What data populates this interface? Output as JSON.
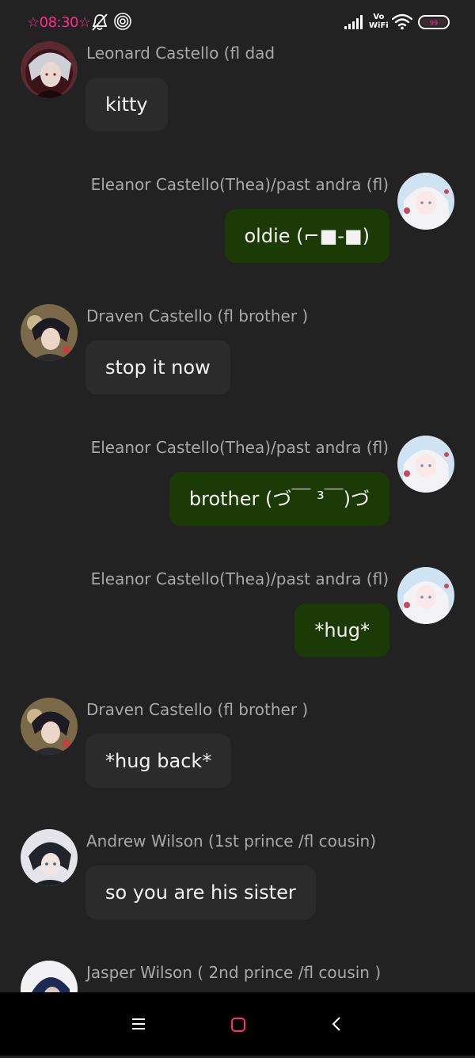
{
  "status_bar": {
    "time": "☆08:30☆",
    "network_badge_top": "Vo",
    "network_badge_bottom": "WiFi",
    "icons": [
      "bell-off-icon",
      "fingerprint-icon",
      "signal-icon",
      "wifi-icon",
      "battery-icon"
    ]
  },
  "messages": [
    {
      "sender": "Leonard Castello (fl dad",
      "text": "kitty",
      "side": "left",
      "avatar": "avatar-leonard"
    },
    {
      "sender": "Eleanor Castello(Thea)/past andra (fl)",
      "text": "oldie (⌐■-■)",
      "side": "right",
      "avatar": "avatar-eleanor"
    },
    {
      "sender": "Draven Castello (fl brother )",
      "text": "stop it now",
      "side": "left",
      "avatar": "avatar-draven"
    },
    {
      "sender": "Eleanor Castello(Thea)/past andra (fl)",
      "text": "brother (づ￣ ³￣)づ",
      "side": "right",
      "avatar": "avatar-eleanor"
    },
    {
      "sender": "Eleanor Castello(Thea)/past andra (fl)",
      "text": "*hug*",
      "side": "right",
      "avatar": "avatar-eleanor"
    },
    {
      "sender": "Draven Castello (fl brother )",
      "text": "*hug back*",
      "side": "left",
      "avatar": "avatar-draven"
    },
    {
      "sender": "Andrew Wilson (1st prince /fl cousin)",
      "text": "so you are his sister",
      "side": "left",
      "avatar": "avatar-andrew"
    },
    {
      "sender": "Jasper Wilson ( 2nd prince /fl cousin )",
      "text": "",
      "side": "left",
      "avatar": "avatar-jasper"
    }
  ],
  "nav_bar": {
    "buttons": [
      "menu-icon",
      "home-icon",
      "back-icon"
    ],
    "home_color": "#ff2d7a"
  },
  "colors": {
    "background": "#222222",
    "incoming_bubble": "#2b2b2b",
    "outgoing_bubble": "#1b3a06",
    "sender_name": "#a9a9a9",
    "time_accent": "#ff2d8a"
  }
}
